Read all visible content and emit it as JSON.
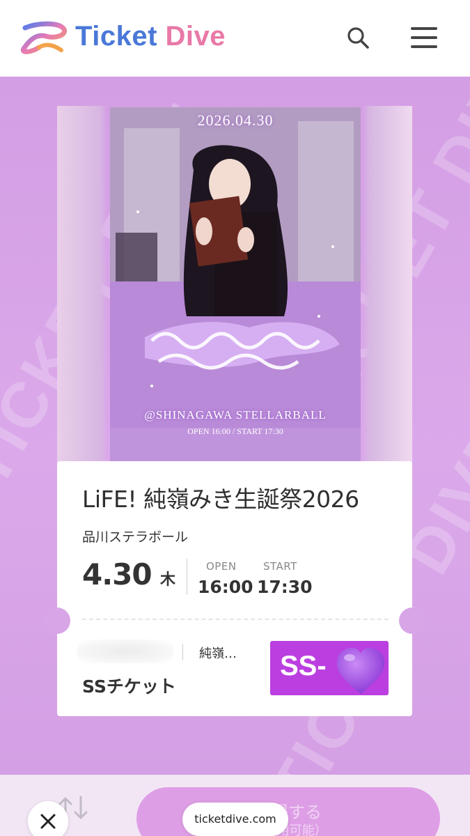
{
  "header": {
    "brand_prefix": "Ticket ",
    "brand_suffix": "Dive",
    "search_icon": "search-icon",
    "menu_icon": "hamburger-menu-icon"
  },
  "background": {
    "watermark": "TICKET DIVE"
  },
  "poster": {
    "date": "2026.04.30",
    "venue": "@SHINAGAWA STELLARBALL",
    "times": "OPEN 16:00 / START 17:30"
  },
  "ticket": {
    "title": "LiFE! 純嶺みき生誕祭2026",
    "venue": "品川ステラボール",
    "date": "4.30",
    "weekday": "木",
    "open_label": "OPEN",
    "open_time": "16:00",
    "start_label": "START",
    "start_time": "17:30",
    "seat_name": "純嶺…",
    "ticket_type": "SSチケット",
    "badge_text": "SS-",
    "badge_icon": "purple-heart-icon"
  },
  "bottom_bar": {
    "enter_label": "入場する",
    "enter_sub": "（より利用可能）",
    "url": "ticketdive.com",
    "close_icon": "close-icon",
    "swap_icon": "swap-arrows-icon"
  },
  "colors": {
    "background": "#d9a7e6",
    "badge": "#bb3fe0",
    "enter_button": "#de9ee6",
    "brand_blue": "#4a78d8",
    "brand_pink": "#e879a8"
  }
}
